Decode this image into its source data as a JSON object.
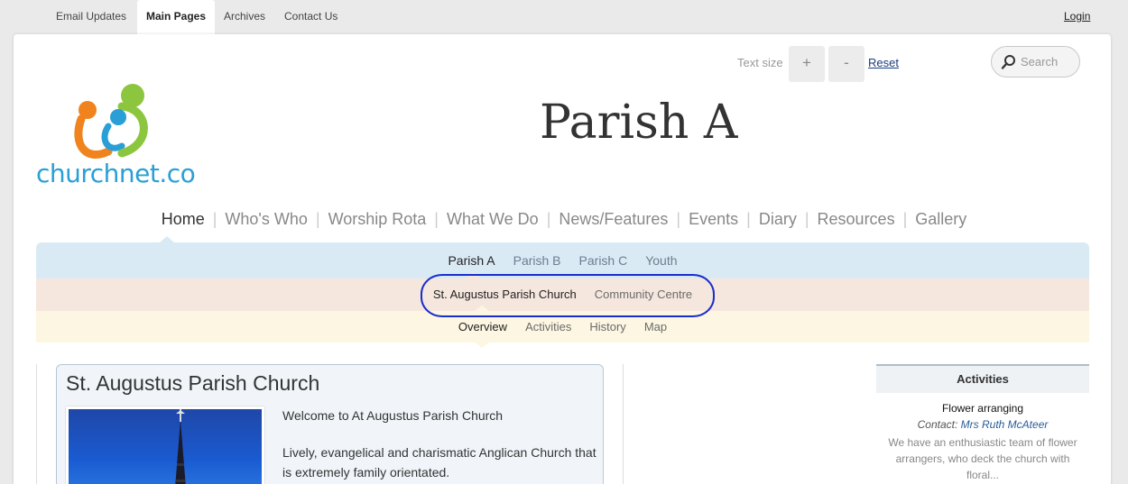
{
  "topbar": {
    "tabs": [
      {
        "label": "Email Updates"
      },
      {
        "label": "Main Pages"
      },
      {
        "label": "Archives"
      },
      {
        "label": "Contact Us"
      }
    ],
    "login_label": "Login"
  },
  "tools": {
    "text_size_label": "Text size",
    "increase_label": "+",
    "decrease_label": "-",
    "reset_label": "Reset",
    "search_placeholder": "Search"
  },
  "logo": {
    "text": "churchnet.co"
  },
  "site_title": "Parish A",
  "main_nav": {
    "items": [
      "Home",
      "Who's Who",
      "Worship Rota",
      "What We Do",
      "News/Features",
      "Events",
      "Diary",
      "Resources",
      "Gallery"
    ],
    "active": "Home"
  },
  "parish_nav": {
    "items": [
      "Parish A",
      "Parish B",
      "Parish C",
      "Youth"
    ],
    "active": "Parish A"
  },
  "location_nav": {
    "items": [
      "St. Augustus Parish Church",
      "Community Centre"
    ],
    "active": "St. Augustus Parish Church"
  },
  "page_nav": {
    "items": [
      "Overview",
      "Activities",
      "History",
      "Map"
    ],
    "active": "Overview"
  },
  "content": {
    "title": "St. Augustus Parish Church",
    "welcome": "Welcome to At Augustus Parish Church",
    "description": "Lively, evangelical and charismatic Anglican Church that is extremely family orientated."
  },
  "activities": {
    "heading": "Activities",
    "item": {
      "title": "Flower arranging",
      "contact_label": "Contact:",
      "contact_name": "Mrs Ruth McAteer",
      "description": "We have an enthusiastic team of flower arrangers, who deck the church with floral..."
    }
  },
  "colors": {
    "accent_blue": "#2a9fd6",
    "logo_green": "#8cc63f",
    "logo_orange": "#f0831e",
    "annotation_blue": "#1a2ecc"
  }
}
